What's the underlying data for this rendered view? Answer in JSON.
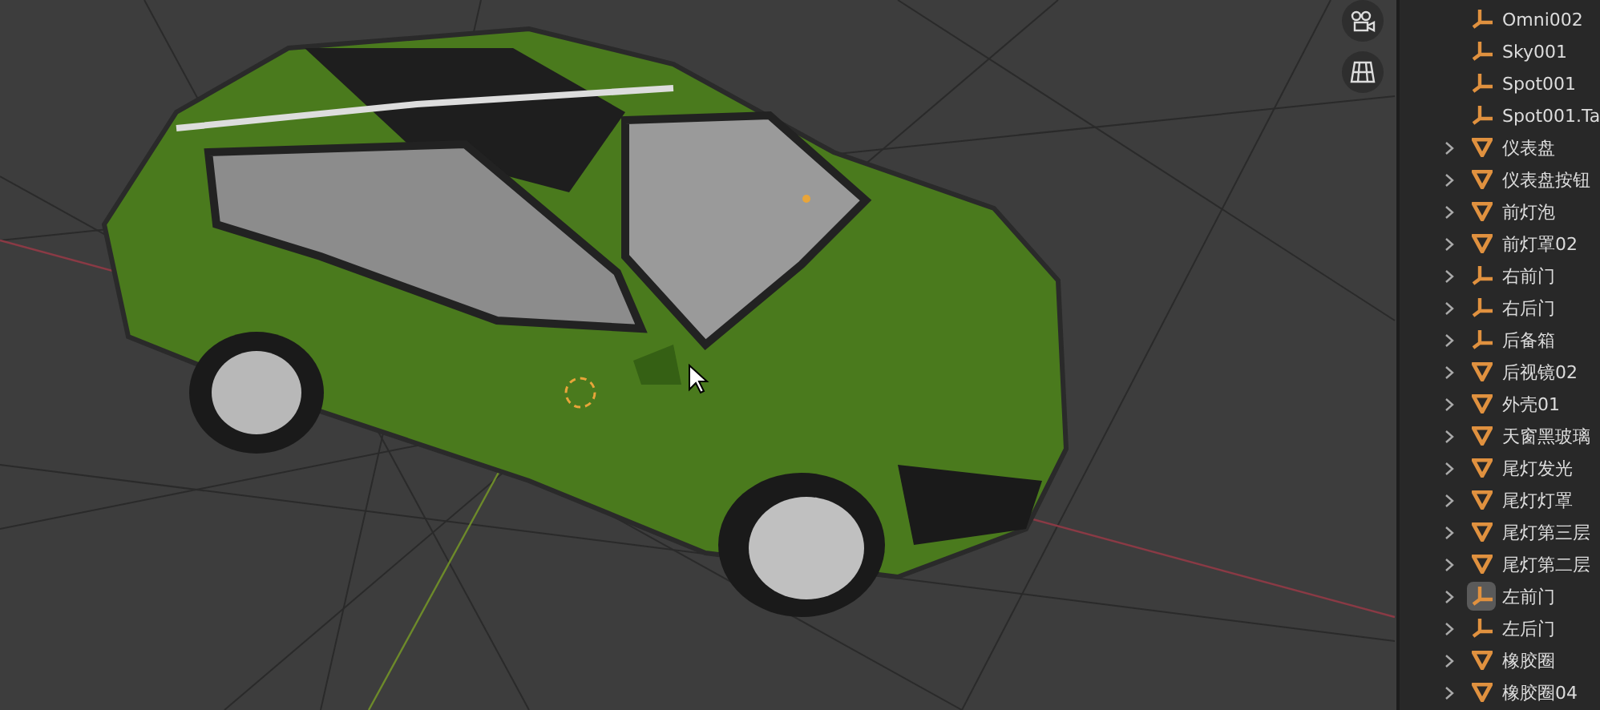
{
  "viewport": {
    "nav_buttons": [
      {
        "kind": "camera"
      },
      {
        "kind": "grid"
      }
    ]
  },
  "outliner": {
    "items": [
      {
        "name": "Omni002",
        "kind": "empty",
        "expandable": false,
        "active": false
      },
      {
        "name": "Sky001",
        "kind": "empty",
        "expandable": false,
        "active": false
      },
      {
        "name": "Spot001",
        "kind": "empty",
        "expandable": false,
        "active": false
      },
      {
        "name": "Spot001.Ta",
        "kind": "empty",
        "expandable": false,
        "active": false
      },
      {
        "name": "仪表盘",
        "kind": "mesh",
        "expandable": true,
        "active": false
      },
      {
        "name": "仪表盘按钮",
        "kind": "mesh",
        "expandable": true,
        "active": false
      },
      {
        "name": "前灯泡",
        "kind": "mesh",
        "expandable": true,
        "active": false
      },
      {
        "name": "前灯罩02",
        "kind": "mesh",
        "expandable": true,
        "active": false
      },
      {
        "name": "右前门",
        "kind": "empty",
        "expandable": true,
        "active": false
      },
      {
        "name": "右后门",
        "kind": "empty",
        "expandable": true,
        "active": false
      },
      {
        "name": "后备箱",
        "kind": "empty",
        "expandable": true,
        "active": false
      },
      {
        "name": "后视镜02",
        "kind": "mesh",
        "expandable": true,
        "active": false
      },
      {
        "name": "外壳01",
        "kind": "mesh",
        "expandable": true,
        "active": false
      },
      {
        "name": "天窗黑玻璃",
        "kind": "mesh",
        "expandable": true,
        "active": false
      },
      {
        "name": "尾灯发光",
        "kind": "mesh",
        "expandable": true,
        "active": false
      },
      {
        "name": "尾灯灯罩",
        "kind": "mesh",
        "expandable": true,
        "active": false
      },
      {
        "name": "尾灯第三层",
        "kind": "mesh",
        "expandable": true,
        "active": false
      },
      {
        "name": "尾灯第二层",
        "kind": "mesh",
        "expandable": true,
        "active": false
      },
      {
        "name": "左前门",
        "kind": "empty",
        "expandable": true,
        "active": true
      },
      {
        "name": "左后门",
        "kind": "empty",
        "expandable": true,
        "active": false
      },
      {
        "name": "橡胶圈",
        "kind": "mesh",
        "expandable": true,
        "active": false
      },
      {
        "name": "橡胶圈04",
        "kind": "mesh",
        "expandable": true,
        "active": false
      }
    ]
  }
}
